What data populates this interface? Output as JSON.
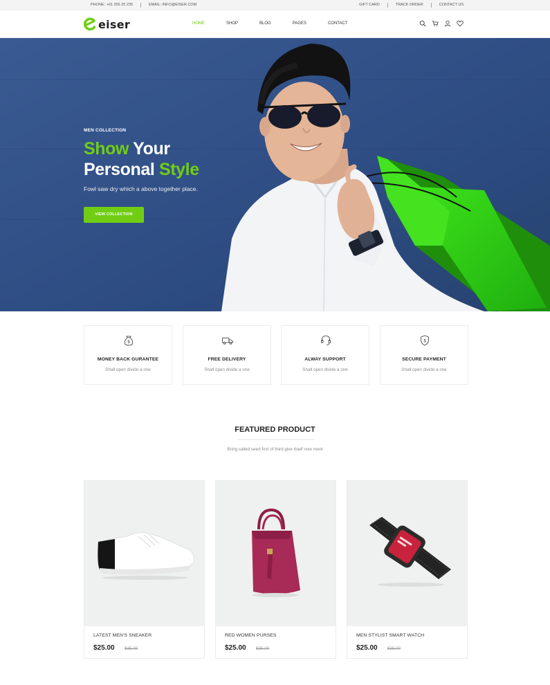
{
  "topbar": {
    "phone": "PHONE: +01 256 25 235",
    "email": "EMAIL: INFO@EISER.COM",
    "links": [
      "GIFT CARD",
      "TRACK ORDER",
      "CONTACT US"
    ]
  },
  "brand": {
    "name": "eiser",
    "accent": "#71cd14"
  },
  "nav": {
    "items": [
      {
        "label": "HOME",
        "active": true
      },
      {
        "label": "SHOP",
        "active": false
      },
      {
        "label": "BLOG",
        "active": false
      },
      {
        "label": "PAGES",
        "active": false
      },
      {
        "label": "CONTACT",
        "active": false
      }
    ],
    "icons": [
      "search-icon",
      "cart-icon",
      "user-icon",
      "heart-icon"
    ]
  },
  "hero": {
    "kicker": "MEN COLLECTION",
    "title_word1": "Show",
    "title_word2": " Your",
    "title_word3": "Personal",
    "title_word4": " Style",
    "subtitle": "Fowl saw dry which a above together place.",
    "button": "VIEW COLLECTION"
  },
  "features": [
    {
      "icon": "money-bag-icon",
      "title": "MONEY BACK GURANTEE",
      "subtitle": "Shall open divide a one"
    },
    {
      "icon": "truck-icon",
      "title": "FREE DELIVERY",
      "subtitle": "Shall open divide a one"
    },
    {
      "icon": "headset-icon",
      "title": "ALWAY SUPPORT",
      "subtitle": "Shall open divide a one"
    },
    {
      "icon": "shield-icon",
      "title": "SECURE PAYMENT",
      "subtitle": "Shall open divide a one"
    }
  ],
  "featured": {
    "title": "FEATURED PRODUCT",
    "subtitle": "Bring called seed first of third give itself now ment"
  },
  "products": [
    {
      "name": "LATEST MEN'S SNEAKER",
      "price": "$25.00",
      "old_price": "$35.00"
    },
    {
      "name": "RED WOMEN PURSES",
      "price": "$25.00",
      "old_price": "$35.00"
    },
    {
      "name": "MEN STYLIST SMART WATCH",
      "price": "$25.00",
      "old_price": "$35.00"
    }
  ]
}
